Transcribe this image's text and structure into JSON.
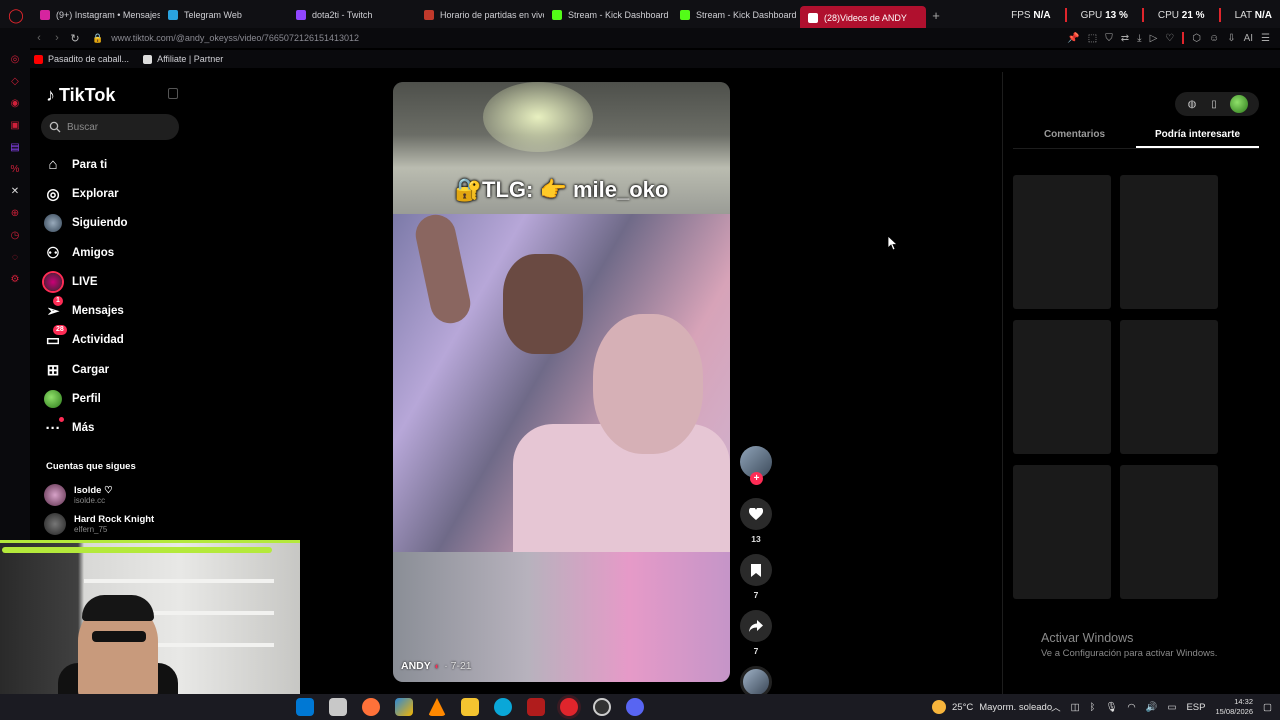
{
  "browser": {
    "tabs": [
      {
        "label": "(9+) Instagram • Mensajes",
        "color": "#d6249f"
      },
      {
        "label": "Telegram Web",
        "color": "#2aa3df"
      },
      {
        "label": "dota2ti - Twitch",
        "color": "#9146ff"
      },
      {
        "label": "Horario de partidas en vivo",
        "color": "#c0392b"
      },
      {
        "label": "Stream - Kick Dashboard",
        "color": "#53fc18"
      },
      {
        "label": "Stream - Kick Dashboard",
        "color": "#53fc18"
      },
      {
        "label": "(28)Videos de ANDY",
        "color": "#ffffff",
        "active": true
      }
    ],
    "hw": {
      "fps_label": "FPS",
      "fps": "N/A",
      "gpu_label": "GPU",
      "gpu": "13 %",
      "cpu_label": "CPU",
      "cpu": "21 %",
      "lat_label": "LAT",
      "lat": "N/A"
    },
    "url": "www.tiktok.com/@andy_okeyss/video/7665072126151413012",
    "ai_label": "AI",
    "bookmarks": [
      {
        "label": "Pasadito de caball...",
        "color": "#ff0000"
      },
      {
        "label": "Affiliate | Partner",
        "color": "#dddddd"
      }
    ]
  },
  "tiktok": {
    "logo": "TikTok",
    "search_placeholder": "Buscar",
    "nav": [
      {
        "label": "Para ti",
        "icon": "home-icon"
      },
      {
        "label": "Explorar",
        "icon": "compass-icon"
      },
      {
        "label": "Siguiendo",
        "icon": "following-avatar"
      },
      {
        "label": "Amigos",
        "icon": "friends-icon"
      },
      {
        "label": "LIVE",
        "icon": "live-avatar"
      },
      {
        "label": "Mensajes",
        "icon": "send-icon",
        "badge": "1"
      },
      {
        "label": "Actividad",
        "icon": "inbox-icon",
        "badge": "28"
      },
      {
        "label": "Cargar",
        "icon": "upload-icon"
      },
      {
        "label": "Perfil",
        "icon": "profile-avatar"
      },
      {
        "label": "Más",
        "icon": "more-icon"
      }
    ],
    "following_header": "Cuentas que sigues",
    "following": [
      {
        "name": "Isolde ♡",
        "handle": "isolde.cc"
      },
      {
        "name": "Hard Rock Knight",
        "handle": "elfern_75"
      }
    ],
    "video": {
      "overlay_text": "🔐TLG: 👉 mile_oko",
      "author": "ANDY",
      "date": "· 7-21"
    },
    "actions": {
      "likes": "13",
      "saves": "7",
      "shares": "7"
    },
    "panel": {
      "tabs": [
        "Comentarios",
        "Podría interesarte"
      ],
      "active_tab": "Podría interesarte"
    }
  },
  "windows": {
    "activate_title": "Activar Windows",
    "activate_sub": "Ve a Configuración para activar Windows.",
    "weather_temp": "25°C",
    "weather_desc": "Mayorm. soleado",
    "lang": "ESP",
    "time": "14:32",
    "date": "15/08/2026"
  },
  "colors": {
    "accent": "#fe2c55",
    "opera_red": "#e0252c",
    "kick_green": "#53fc18"
  }
}
